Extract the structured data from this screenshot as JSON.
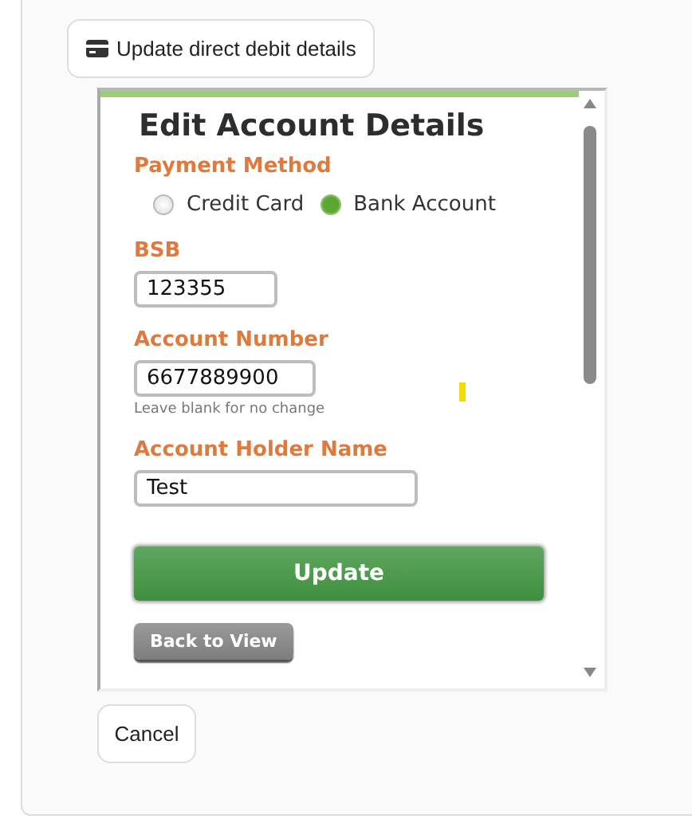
{
  "open_button": {
    "label": "Update direct debit details"
  },
  "form": {
    "title": "Edit Account Details",
    "payment_method": {
      "label": "Payment Method",
      "options": [
        {
          "label": "Credit Card",
          "selected": false
        },
        {
          "label": "Bank Account",
          "selected": true
        }
      ]
    },
    "fields": [
      {
        "label": "BSB",
        "value": "123355"
      },
      {
        "label": "Account Number",
        "value": "6677889900",
        "hint": "Leave blank for no change"
      },
      {
        "label": "Account Holder Name",
        "value": "Test"
      }
    ],
    "submit_button": "Update",
    "back_button": "Back to View"
  },
  "cancel_button": "Cancel"
}
